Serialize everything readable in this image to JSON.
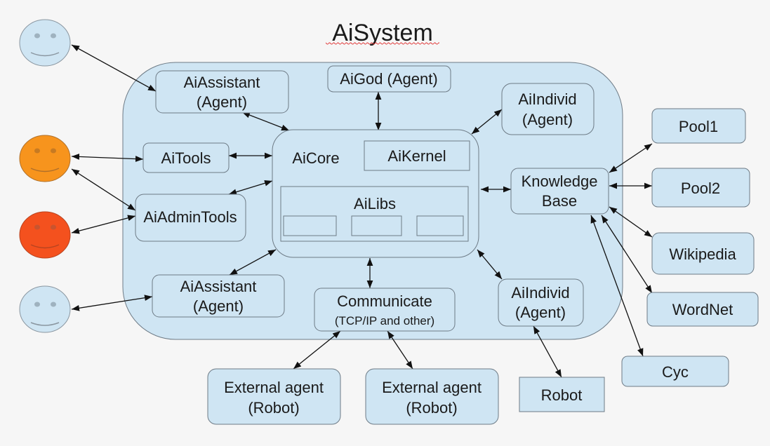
{
  "title": "AiSystem",
  "colors": {
    "background": "#f6f6f6",
    "node_fill": "#cfe5f3",
    "node_stroke": "#6e7b86",
    "container_fill": "#cfe5f3",
    "arrow": "#111111",
    "actor_blue": "#cfe5f3",
    "actor_orange": "#f7941d",
    "actor_red": "#f4511e"
  },
  "nodes": {
    "ai_assistant_top": {
      "line1": "AiAssistant",
      "line2": "(Agent)"
    },
    "ai_god": {
      "line1": "AiGod (Agent)"
    },
    "ai_individ_top": {
      "line1": "AiIndivid",
      "line2": "(Agent)"
    },
    "ai_tools": {
      "line1": "AiTools"
    },
    "ai_admin_tools": {
      "line1": "AiAdminTools"
    },
    "ai_core": {
      "line1": "AiCore"
    },
    "ai_kernel": {
      "line1": "AiKernel"
    },
    "ai_libs": {
      "line1": "AiLibs"
    },
    "ai_assistant_bottom": {
      "line1": "AiAssistant",
      "line2": "(Agent)"
    },
    "communicate": {
      "line1": "Communicate",
      "line2": "(TCP/IP and other)"
    },
    "ai_individ_bottom": {
      "line1": "AiIndivid",
      "line2": "(Agent)"
    },
    "knowledge_base": {
      "line1": "Knowledge",
      "line2": "Base"
    },
    "pool1": {
      "line1": "Pool1"
    },
    "pool2": {
      "line1": "Pool2"
    },
    "wikipedia": {
      "line1": "Wikipedia"
    },
    "wordnet": {
      "line1": "WordNet"
    },
    "cyc": {
      "line1": "Cyc"
    },
    "external_agent_1": {
      "line1": "External agent",
      "line2": "(Robot)"
    },
    "external_agent_2": {
      "line1": "External agent",
      "line2": "(Robot)"
    },
    "robot": {
      "line1": "Robot"
    }
  },
  "actors": [
    {
      "id": "user-1",
      "color": "blue"
    },
    {
      "id": "user-2",
      "color": "orange"
    },
    {
      "id": "user-3",
      "color": "red"
    },
    {
      "id": "user-4",
      "color": "blue"
    }
  ],
  "edges": [
    {
      "from": "user-1",
      "to": "ai_assistant_top",
      "direction": "both"
    },
    {
      "from": "user-2",
      "to": "ai_tools",
      "direction": "both"
    },
    {
      "from": "user-2",
      "to": "ai_admin_tools",
      "direction": "both"
    },
    {
      "from": "user-3",
      "to": "ai_admin_tools",
      "direction": "both"
    },
    {
      "from": "user-4",
      "to": "ai_assistant_bottom",
      "direction": "both"
    },
    {
      "from": "ai_assistant_top",
      "to": "ai_core",
      "direction": "both"
    },
    {
      "from": "ai_god",
      "to": "ai_core",
      "direction": "both"
    },
    {
      "from": "ai_individ_top",
      "to": "ai_core",
      "direction": "both"
    },
    {
      "from": "ai_tools",
      "to": "ai_core",
      "direction": "both"
    },
    {
      "from": "ai_admin_tools",
      "to": "ai_core",
      "direction": "both"
    },
    {
      "from": "ai_assistant_bottom",
      "to": "ai_core",
      "direction": "both"
    },
    {
      "from": "communicate",
      "to": "ai_core",
      "direction": "both"
    },
    {
      "from": "ai_individ_bottom",
      "to": "ai_core",
      "direction": "both"
    },
    {
      "from": "knowledge_base",
      "to": "ai_core",
      "direction": "both"
    },
    {
      "from": "knowledge_base",
      "to": "pool1",
      "direction": "both"
    },
    {
      "from": "knowledge_base",
      "to": "pool2",
      "direction": "both"
    },
    {
      "from": "knowledge_base",
      "to": "wikipedia",
      "direction": "both"
    },
    {
      "from": "knowledge_base",
      "to": "wordnet",
      "direction": "both"
    },
    {
      "from": "knowledge_base",
      "to": "cyc",
      "direction": "both"
    },
    {
      "from": "communicate",
      "to": "external_agent_1",
      "direction": "both"
    },
    {
      "from": "communicate",
      "to": "external_agent_2",
      "direction": "both"
    },
    {
      "from": "ai_individ_bottom",
      "to": "robot",
      "direction": "both"
    }
  ]
}
